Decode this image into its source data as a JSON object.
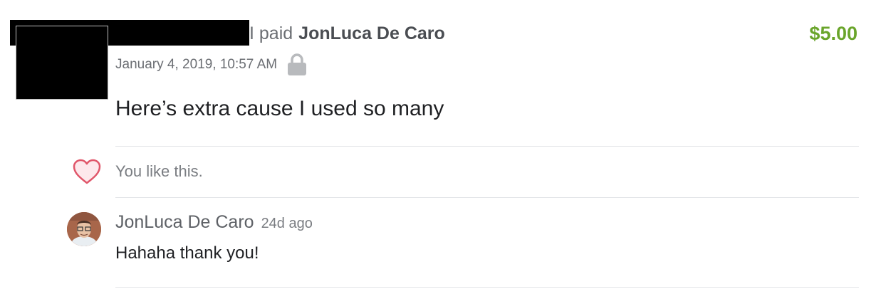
{
  "transaction": {
    "action_text": "I paid",
    "payee": "JonLuca De Caro",
    "amount": "$5.00",
    "date": "January 4, 2019, 10:57 AM",
    "privacy_icon": "lock-icon",
    "note": "Here’s extra cause I used so many"
  },
  "likes": {
    "icon": "heart-icon",
    "text": "You like this."
  },
  "comment": {
    "author": "JonLuca De Caro",
    "time": "24d ago",
    "body": "Hahaha thank you!"
  },
  "colors": {
    "amount": "#6aa52b",
    "heart": "#e0566a",
    "divider": "#e3e5e8"
  }
}
